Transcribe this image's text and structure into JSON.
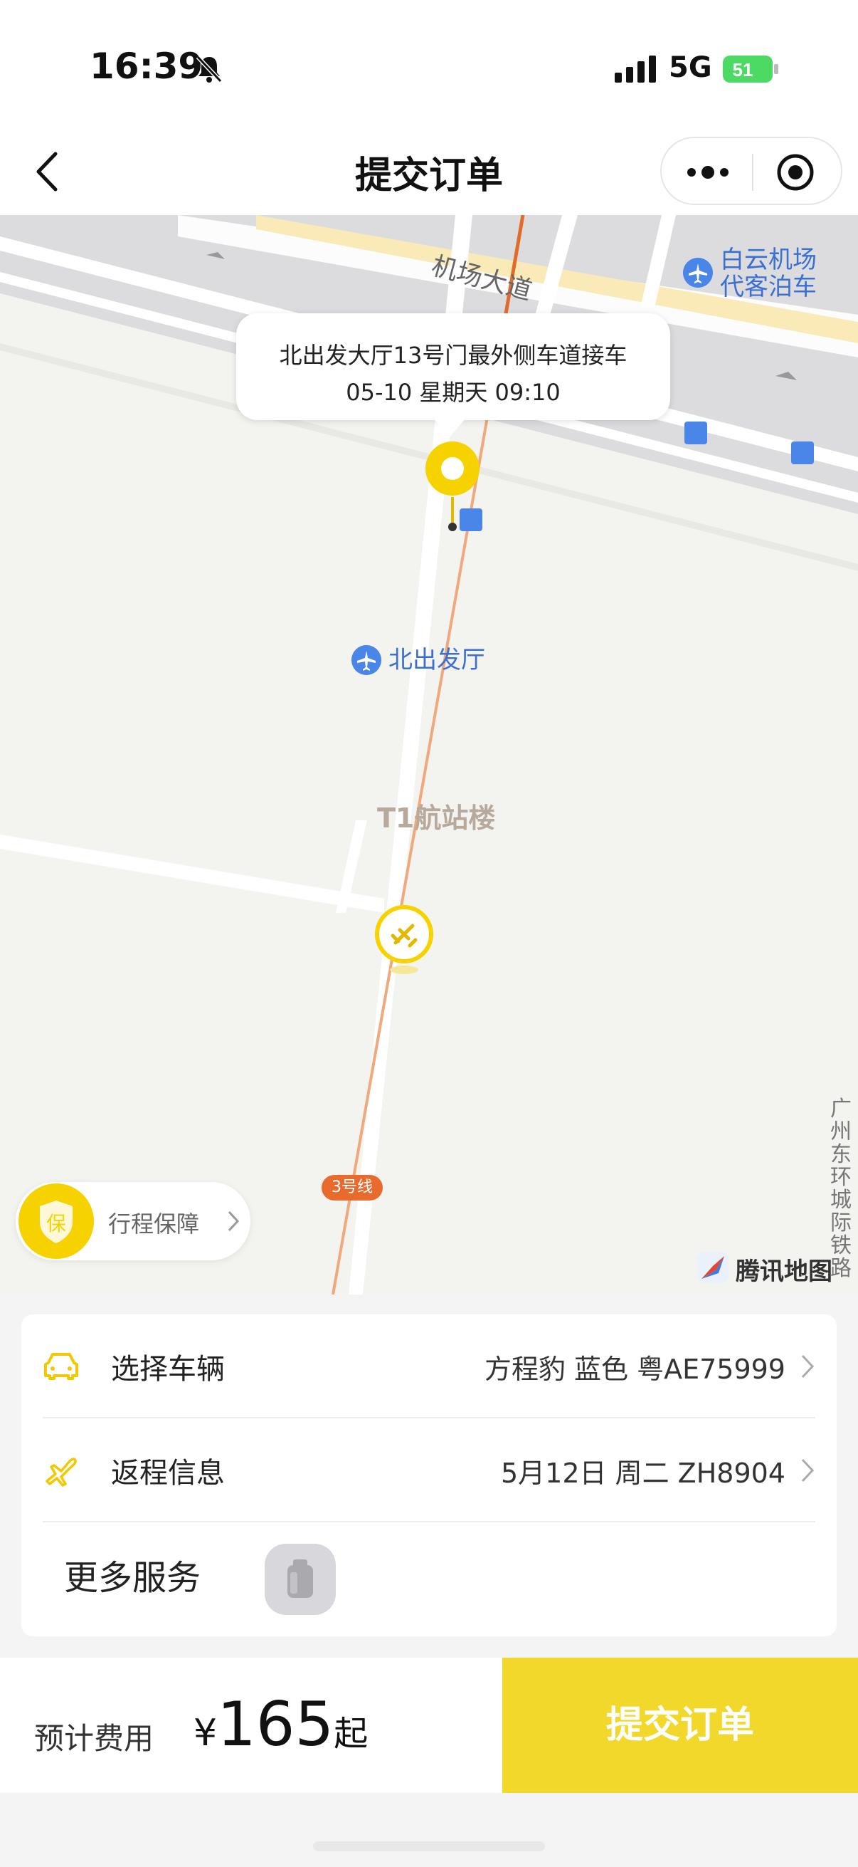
{
  "status_bar": {
    "time": "16:39",
    "network": "5G",
    "battery": "51"
  },
  "navbar": {
    "title": "提交订单",
    "more_icon": "more-icon",
    "target_icon": "target-icon"
  },
  "map": {
    "road_airport": "机场大道",
    "poi_parking": "白云机场\n代客泊车",
    "callout_line1": "北出发大厅13号门最外侧车道接车",
    "callout_line2": "05-10 星期天 09:10",
    "poi_north": "北出发厅",
    "area_t1": "T1航站楼",
    "metro_line": "3号线",
    "guard_label": "行程保障",
    "guard_badge": "保",
    "rail_label": "广州东环城际铁路",
    "provider": "腾讯地图"
  },
  "card": {
    "vehicle_label": "选择车辆",
    "vehicle_value": "方程豹 蓝色 粤AE75999",
    "return_label": "返程信息",
    "return_value": "5月12日 周二 ZH8904",
    "more_label": "更多服务"
  },
  "bottom": {
    "fee_label": "预计费用",
    "currency": "¥",
    "price": "165",
    "price_suffix": "起",
    "submit": "提交订单"
  },
  "colors": {
    "accent": "#f2d82b",
    "poi": "#4a86e8",
    "metro": "#e86a2c"
  }
}
